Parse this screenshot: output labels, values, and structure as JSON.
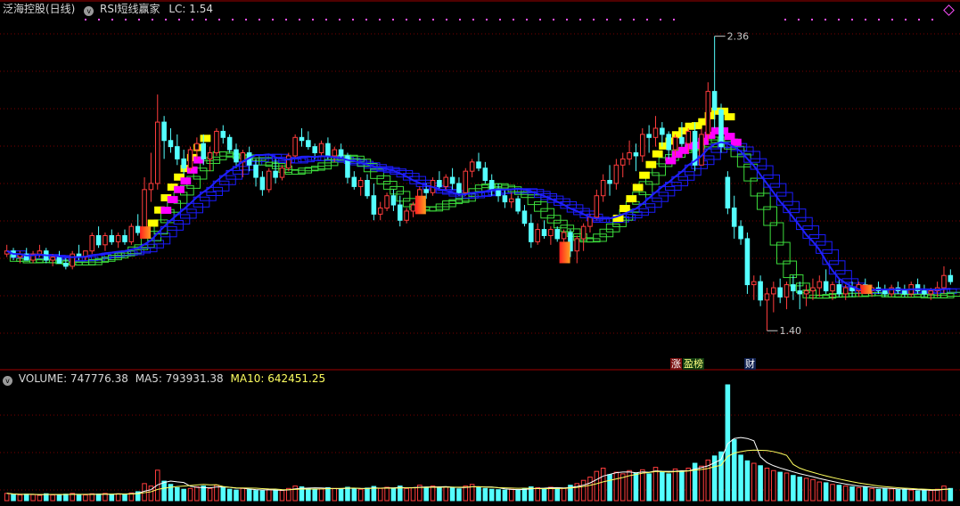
{
  "header": {
    "stock_name": "泛海控股(日线)",
    "indicator_name": "RSI短线赢家",
    "indicator_lc_label": "LC:",
    "indicator_lc_value": "1.54"
  },
  "volume_header": {
    "volume_label": "VOLUME:",
    "volume_value": "747776.38",
    "ma5_label": "MA5:",
    "ma5_value": "793931.38",
    "ma10_label": "MA10:",
    "ma10_value": "642451.25"
  },
  "markers": {
    "zhang": "涨",
    "yingbang": "盈榜",
    "cai": "财"
  },
  "colors": {
    "up": "#ff3d3d",
    "down": "#54ffff",
    "grid": "#7a0000",
    "ma5": "#ffffff",
    "ma10": "#ffff60",
    "ladder_blue": "#1c1cff",
    "ladder_green": "#3cdc3c",
    "band_yellow": "#ffff00",
    "band_magenta": "#ff00ff"
  },
  "chart_data": {
    "type": "candlestick",
    "title": "泛海控股(日线)",
    "annotations": [
      {
        "text": "2.36",
        "kind": "high"
      },
      {
        "text": "1.40",
        "kind": "low"
      }
    ],
    "ylim": [
      1.36,
      2.42
    ],
    "ohlc": [
      [
        1.65,
        1.68,
        1.64,
        1.66
      ],
      [
        1.66,
        1.67,
        1.63,
        1.64
      ],
      [
        1.64,
        1.66,
        1.62,
        1.65
      ],
      [
        1.65,
        1.67,
        1.63,
        1.63
      ],
      [
        1.63,
        1.66,
        1.62,
        1.65
      ],
      [
        1.65,
        1.68,
        1.64,
        1.66
      ],
      [
        1.66,
        1.67,
        1.62,
        1.63
      ],
      [
        1.63,
        1.65,
        1.61,
        1.64
      ],
      [
        1.64,
        1.66,
        1.62,
        1.62
      ],
      [
        1.62,
        1.64,
        1.6,
        1.61
      ],
      [
        1.61,
        1.66,
        1.6,
        1.65
      ],
      [
        1.65,
        1.68,
        1.63,
        1.64
      ],
      [
        1.64,
        1.66,
        1.63,
        1.66
      ],
      [
        1.66,
        1.72,
        1.65,
        1.71
      ],
      [
        1.71,
        1.74,
        1.67,
        1.68
      ],
      [
        1.68,
        1.72,
        1.66,
        1.71
      ],
      [
        1.71,
        1.73,
        1.68,
        1.69
      ],
      [
        1.69,
        1.72,
        1.67,
        1.71
      ],
      [
        1.71,
        1.73,
        1.68,
        1.69
      ],
      [
        1.69,
        1.75,
        1.68,
        1.74
      ],
      [
        1.74,
        1.78,
        1.71,
        1.72
      ],
      [
        1.72,
        1.9,
        1.7,
        1.86
      ],
      [
        1.86,
        1.98,
        1.82,
        1.88
      ],
      [
        1.88,
        2.17,
        1.86,
        2.08
      ],
      [
        2.08,
        2.1,
        1.96,
        2.02
      ],
      [
        2.02,
        2.06,
        1.98,
        2.0
      ],
      [
        2.0,
        2.04,
        1.94,
        1.96
      ],
      [
        1.96,
        1.99,
        1.91,
        1.93
      ],
      [
        1.93,
        2.0,
        1.92,
        1.99
      ],
      [
        1.99,
        2.03,
        1.96,
        2.01
      ],
      [
        2.01,
        2.04,
        1.94,
        1.96
      ],
      [
        1.96,
        2.0,
        1.92,
        1.98
      ],
      [
        1.98,
        2.06,
        1.97,
        2.05
      ],
      [
        2.05,
        2.07,
        2.01,
        2.03
      ],
      [
        2.03,
        2.04,
        1.98,
        1.99
      ],
      [
        1.99,
        2.01,
        1.93,
        1.95
      ],
      [
        1.95,
        1.99,
        1.9,
        1.98
      ],
      [
        1.98,
        2.0,
        1.92,
        1.94
      ],
      [
        1.94,
        1.96,
        1.87,
        1.9
      ],
      [
        1.9,
        1.92,
        1.84,
        1.86
      ],
      [
        1.86,
        1.93,
        1.85,
        1.92
      ],
      [
        1.92,
        1.96,
        1.88,
        1.9
      ],
      [
        1.9,
        1.94,
        1.89,
        1.93
      ],
      [
        1.93,
        1.98,
        1.92,
        1.97
      ],
      [
        1.97,
        2.04,
        1.96,
        2.03
      ],
      [
        2.03,
        2.06,
        2.0,
        2.02
      ],
      [
        2.02,
        2.05,
        1.99,
        2.0
      ],
      [
        2.0,
        2.01,
        1.96,
        1.98
      ],
      [
        1.98,
        2.02,
        1.97,
        2.01
      ],
      [
        2.01,
        2.03,
        1.96,
        1.97
      ],
      [
        1.97,
        2.0,
        1.95,
        1.99
      ],
      [
        1.99,
        2.01,
        1.96,
        1.97
      ],
      [
        1.97,
        1.98,
        1.88,
        1.9
      ],
      [
        1.9,
        1.92,
        1.86,
        1.87
      ],
      [
        1.87,
        1.9,
        1.84,
        1.89
      ],
      [
        1.89,
        1.91,
        1.83,
        1.84
      ],
      [
        1.84,
        1.88,
        1.76,
        1.78
      ],
      [
        1.78,
        1.82,
        1.76,
        1.8
      ],
      [
        1.8,
        1.85,
        1.79,
        1.84
      ],
      [
        1.84,
        1.86,
        1.79,
        1.81
      ],
      [
        1.81,
        1.84,
        1.74,
        1.76
      ],
      [
        1.76,
        1.8,
        1.75,
        1.79
      ],
      [
        1.79,
        1.82,
        1.77,
        1.81
      ],
      [
        1.81,
        1.87,
        1.8,
        1.86
      ],
      [
        1.86,
        1.88,
        1.83,
        1.85
      ],
      [
        1.85,
        1.9,
        1.84,
        1.89
      ],
      [
        1.89,
        1.92,
        1.86,
        1.87
      ],
      [
        1.87,
        1.91,
        1.86,
        1.9
      ],
      [
        1.9,
        1.93,
        1.86,
        1.88
      ],
      [
        1.88,
        1.9,
        1.84,
        1.85
      ],
      [
        1.85,
        1.93,
        1.84,
        1.92
      ],
      [
        1.92,
        1.96,
        1.9,
        1.95
      ],
      [
        1.95,
        1.98,
        1.92,
        1.93
      ],
      [
        1.93,
        1.95,
        1.88,
        1.89
      ],
      [
        1.89,
        1.91,
        1.84,
        1.86
      ],
      [
        1.86,
        1.88,
        1.82,
        1.84
      ],
      [
        1.84,
        1.86,
        1.8,
        1.82
      ],
      [
        1.82,
        1.85,
        1.8,
        1.83
      ],
      [
        1.83,
        1.84,
        1.78,
        1.79
      ],
      [
        1.79,
        1.81,
        1.74,
        1.75
      ],
      [
        1.75,
        1.78,
        1.67,
        1.69
      ],
      [
        1.69,
        1.75,
        1.68,
        1.73
      ],
      [
        1.73,
        1.76,
        1.7,
        1.71
      ],
      [
        1.71,
        1.74,
        1.68,
        1.73
      ],
      [
        1.73,
        1.74,
        1.69,
        1.7
      ],
      [
        1.7,
        1.73,
        1.69,
        1.72
      ],
      [
        1.72,
        1.73,
        1.64,
        1.66
      ],
      [
        1.66,
        1.71,
        1.62,
        1.7
      ],
      [
        1.7,
        1.75,
        1.66,
        1.74
      ],
      [
        1.74,
        1.78,
        1.72,
        1.77
      ],
      [
        1.77,
        1.86,
        1.76,
        1.84
      ],
      [
        1.84,
        1.91,
        1.82,
        1.89
      ],
      [
        1.89,
        1.94,
        1.84,
        1.88
      ],
      [
        1.88,
        1.96,
        1.86,
        1.94
      ],
      [
        1.94,
        1.98,
        1.9,
        1.96
      ],
      [
        1.96,
        2.02,
        1.94,
        1.98
      ],
      [
        1.98,
        2.01,
        1.92,
        1.97
      ],
      [
        1.97,
        2.06,
        1.95,
        2.04
      ],
      [
        2.04,
        2.07,
        1.98,
        2.03
      ],
      [
        2.03,
        2.1,
        2.0,
        2.06
      ],
      [
        2.06,
        2.08,
        2.0,
        2.04
      ],
      [
        2.04,
        2.05,
        1.96,
        1.99
      ],
      [
        1.99,
        2.04,
        1.97,
        2.03
      ],
      [
        2.03,
        2.08,
        2.0,
        2.01
      ],
      [
        2.01,
        2.06,
        1.98,
        2.05
      ],
      [
        2.05,
        2.08,
        1.92,
        1.94
      ],
      [
        1.94,
        2.06,
        1.94,
        2.04
      ],
      [
        2.04,
        2.21,
        2.02,
        2.18
      ],
      [
        2.18,
        2.36,
        2.06,
        2.12
      ],
      [
        2.12,
        2.14,
        1.98,
        2.0
      ],
      [
        1.9,
        1.92,
        1.78,
        1.8
      ],
      [
        1.8,
        1.84,
        1.7,
        1.74
      ],
      [
        1.74,
        1.76,
        1.68,
        1.7
      ],
      [
        1.7,
        1.72,
        1.52,
        1.55
      ],
      [
        1.55,
        1.58,
        1.5,
        1.56
      ],
      [
        1.56,
        1.58,
        1.48,
        1.5
      ],
      [
        1.5,
        1.54,
        1.4,
        1.52
      ],
      [
        1.52,
        1.56,
        1.46,
        1.54
      ],
      [
        1.54,
        1.57,
        1.49,
        1.51
      ],
      [
        1.51,
        1.56,
        1.47,
        1.55
      ],
      [
        1.55,
        1.58,
        1.5,
        1.53
      ],
      [
        1.53,
        1.56,
        1.47,
        1.52
      ],
      [
        1.52,
        1.55,
        1.48,
        1.53
      ],
      [
        1.53,
        1.57,
        1.5,
        1.54
      ],
      [
        1.54,
        1.58,
        1.51,
        1.56
      ],
      [
        1.56,
        1.6,
        1.52,
        1.53
      ],
      [
        1.53,
        1.56,
        1.5,
        1.55
      ],
      [
        1.55,
        1.57,
        1.51,
        1.52
      ],
      [
        1.52,
        1.55,
        1.5,
        1.54
      ],
      [
        1.54,
        1.56,
        1.51,
        1.53
      ],
      [
        1.53,
        1.56,
        1.51,
        1.55
      ],
      [
        1.55,
        1.57,
        1.52,
        1.53
      ],
      [
        1.53,
        1.55,
        1.51,
        1.54
      ],
      [
        1.54,
        1.56,
        1.52,
        1.53
      ],
      [
        1.53,
        1.55,
        1.51,
        1.52
      ],
      [
        1.52,
        1.55,
        1.51,
        1.54
      ],
      [
        1.54,
        1.56,
        1.52,
        1.53
      ],
      [
        1.53,
        1.55,
        1.51,
        1.52
      ],
      [
        1.52,
        1.56,
        1.51,
        1.55
      ],
      [
        1.55,
        1.57,
        1.52,
        1.53
      ],
      [
        1.53,
        1.55,
        1.51,
        1.52
      ],
      [
        1.52,
        1.54,
        1.5,
        1.53
      ],
      [
        1.53,
        1.56,
        1.51,
        1.54
      ],
      [
        1.54,
        1.61,
        1.52,
        1.58
      ],
      [
        1.58,
        1.6,
        1.55,
        1.56
      ]
    ],
    "volume": [
      0.18,
      0.15,
      0.14,
      0.16,
      0.15,
      0.13,
      0.17,
      0.14,
      0.15,
      0.16,
      0.18,
      0.15,
      0.14,
      0.17,
      0.16,
      0.18,
      0.15,
      0.17,
      0.16,
      0.19,
      0.22,
      0.42,
      0.36,
      0.75,
      0.48,
      0.4,
      0.32,
      0.28,
      0.3,
      0.34,
      0.36,
      0.3,
      0.38,
      0.32,
      0.28,
      0.26,
      0.3,
      0.27,
      0.25,
      0.24,
      0.28,
      0.26,
      0.25,
      0.3,
      0.36,
      0.34,
      0.3,
      0.27,
      0.29,
      0.32,
      0.3,
      0.28,
      0.33,
      0.3,
      0.28,
      0.31,
      0.35,
      0.3,
      0.33,
      0.29,
      0.36,
      0.3,
      0.32,
      0.38,
      0.33,
      0.36,
      0.31,
      0.34,
      0.32,
      0.29,
      0.36,
      0.4,
      0.34,
      0.3,
      0.28,
      0.27,
      0.26,
      0.28,
      0.27,
      0.3,
      0.34,
      0.32,
      0.3,
      0.33,
      0.31,
      0.3,
      0.38,
      0.42,
      0.5,
      0.58,
      0.72,
      0.8,
      0.64,
      0.7,
      0.66,
      0.74,
      0.68,
      0.76,
      0.66,
      0.82,
      0.7,
      0.66,
      0.78,
      0.72,
      0.8,
      0.92,
      0.85,
      1.0,
      1.1,
      1.2,
      2.85,
      1.5,
      1.12,
      0.98,
      0.92,
      0.86,
      0.8,
      0.74,
      0.7,
      0.68,
      0.62,
      0.58,
      0.55,
      0.52,
      0.46,
      0.44,
      0.4,
      0.38,
      0.36,
      0.34,
      0.32,
      0.34,
      0.3,
      0.28,
      0.3,
      0.29,
      0.27,
      0.28,
      0.26,
      0.24,
      0.26,
      0.25,
      0.28,
      0.36,
      0.3
    ]
  }
}
